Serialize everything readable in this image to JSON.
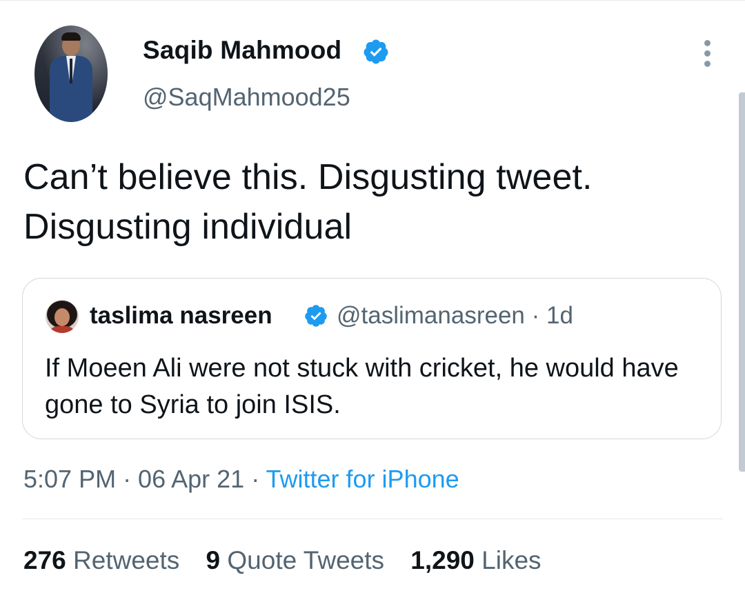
{
  "tweet": {
    "author": {
      "name": "Saqib Mahmood",
      "handle": "@SaqMahmood25",
      "verified": true
    },
    "text": "Can’t believe this. Disgusting tweet. Disgusting individual",
    "quoted": {
      "name": "taslima nasreen",
      "handle_and_age": "@taslimanasreen · 1d",
      "verified": true,
      "text": "If Moeen Ali were not stuck with cricket,  he would have gone to Syria to join ISIS."
    },
    "meta": {
      "time_date": "5:07 PM · 06 Apr 21 · ",
      "source": "Twitter for iPhone"
    },
    "stats": {
      "retweets_count": "276",
      "retweets_label": "Retweets",
      "quotes_count": "9",
      "quotes_label": "Quote Tweets",
      "likes_count": "1,290",
      "likes_label": "Likes"
    }
  },
  "colors": {
    "accent": "#1d9bf0",
    "secondary_text": "#536471",
    "primary_text": "#0f1419",
    "border": "#cfd9de"
  },
  "icons": {
    "verified": "verified-badge-icon",
    "more": "more-options-icon"
  }
}
